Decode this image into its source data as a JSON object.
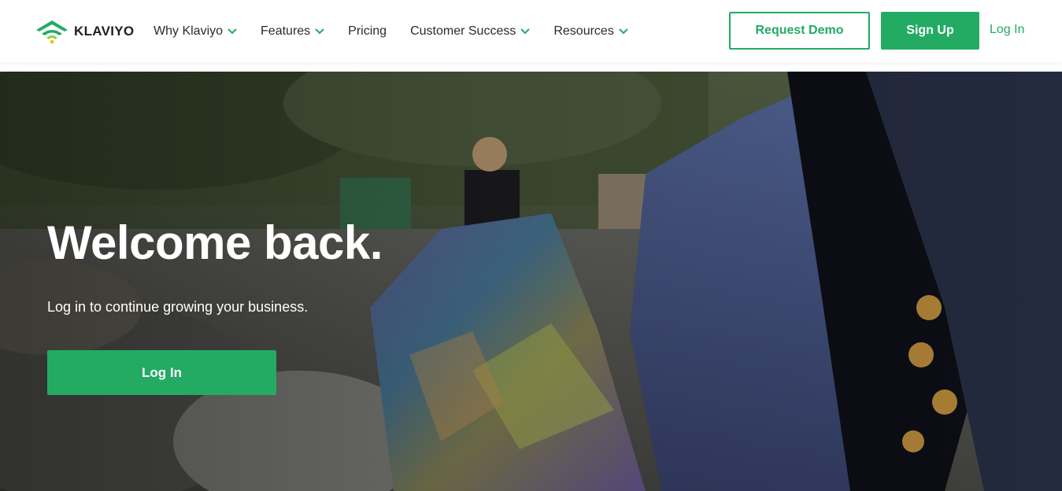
{
  "brand": {
    "name": "KLAVIYO",
    "logo_icon": "wifi-signal-logo-icon",
    "accent_color": "#23ab64"
  },
  "nav": {
    "items": [
      {
        "label": "Why Klaviyo",
        "has_dropdown": true
      },
      {
        "label": "Features",
        "has_dropdown": true
      },
      {
        "label": "Pricing",
        "has_dropdown": false
      },
      {
        "label": "Customer Success",
        "has_dropdown": true
      },
      {
        "label": "Resources",
        "has_dropdown": true
      }
    ],
    "request_demo_label": "Request Demo",
    "sign_up_label": "Sign Up",
    "log_in_label": "Log In"
  },
  "hero": {
    "title": "Welcome back.",
    "subtitle": "Log in to continue growing your business.",
    "cta_label": "Log In",
    "background": "photo-outdoor-people-holding-colorful-fabric"
  }
}
